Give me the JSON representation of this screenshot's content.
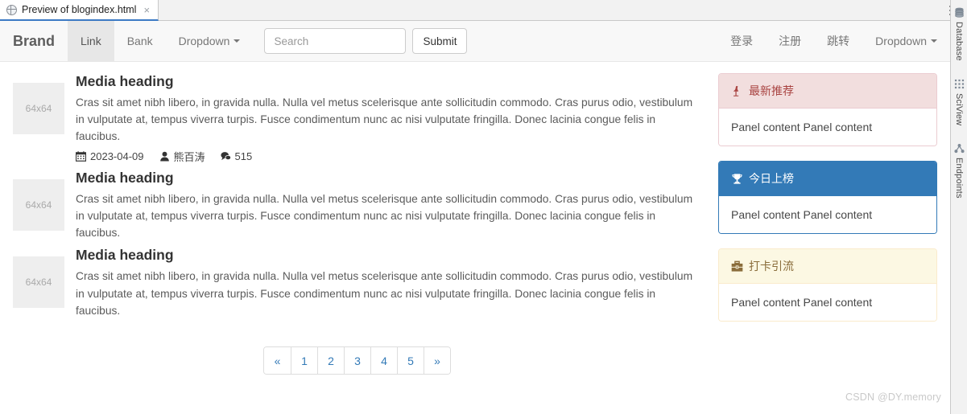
{
  "ide": {
    "tab": {
      "icon": "globe-icon",
      "title": "Preview of blogindex.html",
      "close": "×"
    },
    "kebab_menu": "more-options",
    "tool_window_buttons": [
      {
        "label": "Database",
        "icon": "database-icon"
      },
      {
        "label": "SciView",
        "icon": "grid-icon"
      },
      {
        "label": "Endpoints",
        "icon": "endpoints-icon"
      }
    ]
  },
  "navbar": {
    "brand": "Brand",
    "left_items": [
      {
        "label": "Link",
        "active": true,
        "caret": false
      },
      {
        "label": "Bank",
        "active": false,
        "caret": false
      },
      {
        "label": "Dropdown",
        "active": false,
        "caret": true
      }
    ],
    "search": {
      "placeholder": "Search",
      "value": "",
      "submit_label": "Submit"
    },
    "right_items": [
      {
        "label": "登录",
        "caret": false
      },
      {
        "label": "注册",
        "caret": false
      },
      {
        "label": "跳转",
        "caret": false
      },
      {
        "label": "Dropdown",
        "caret": true
      }
    ]
  },
  "media_list": [
    {
      "thumb_label": "64x64",
      "heading": "Media heading",
      "text": "Cras sit amet nibh libero, in gravida nulla. Nulla vel metus scelerisque ante sollicitudin commodo. Cras purus odio, vestibulum in vulputate at, tempus viverra turpis. Fusce condimentum nunc ac nisi vulputate fringilla. Donec lacinia congue felis in faucibus.",
      "meta": {
        "date_icon": "calendar-icon",
        "date": "2023-04-09",
        "author_icon": "user-icon",
        "author": "熊百涛",
        "comments_icon": "comment-icon",
        "comments": "515"
      }
    },
    {
      "thumb_label": "64x64",
      "heading": "Media heading",
      "text": "Cras sit amet nibh libero, in gravida nulla. Nulla vel metus scelerisque ante sollicitudin commodo. Cras purus odio, vestibulum in vulputate at, tempus viverra turpis. Fusce condimentum nunc ac nisi vulputate fringilla. Donec lacinia congue felis in faucibus.",
      "meta": null
    },
    {
      "thumb_label": "64x64",
      "heading": "Media heading",
      "text": "Cras sit amet nibh libero, in gravida nulla. Nulla vel metus scelerisque ante sollicitudin commodo. Cras purus odio, vestibulum in vulputate at, tempus viverra turpis. Fusce condimentum nunc ac nisi vulputate fringilla. Donec lacinia congue felis in faucibus.",
      "meta": null
    }
  ],
  "pagination": {
    "prev": "«",
    "pages": [
      "1",
      "2",
      "3",
      "4",
      "5"
    ],
    "next": "»"
  },
  "panels": [
    {
      "style": "danger",
      "icon": "thumbtack-icon",
      "title": "最新推荐",
      "body": "Panel content Panel content",
      "header_bg": "#f2dede",
      "header_fg": "#a94442",
      "border": "#ebccd1"
    },
    {
      "style": "primary",
      "icon": "trophy-icon",
      "title": "今日上榜",
      "body": "Panel content Panel content",
      "header_bg": "#337ab7",
      "header_fg": "#ffffff",
      "border": "#337ab7"
    },
    {
      "style": "warning",
      "icon": "briefcase-icon",
      "title": "打卡引流",
      "body": "Panel content Panel content",
      "header_bg": "#fcf8e3",
      "header_fg": "#8a6d3b",
      "border": "#faebcc"
    }
  ],
  "watermark": "CSDN @DY.memory"
}
